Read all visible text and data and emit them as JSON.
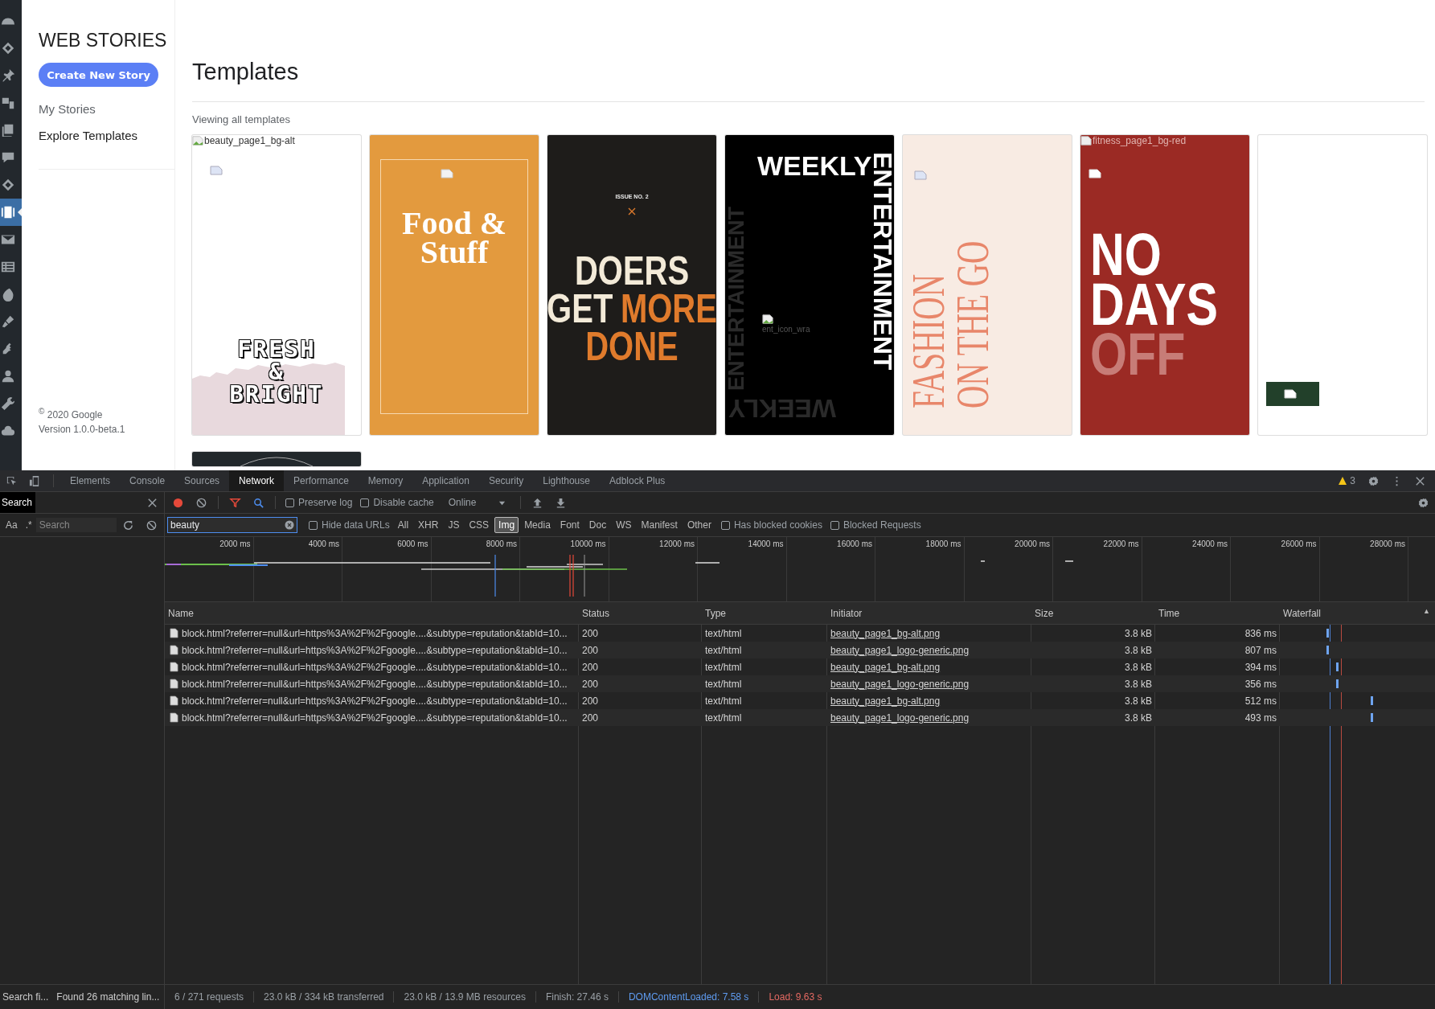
{
  "admin_menu": [
    {
      "selected": false
    },
    {
      "selected": false
    },
    {
      "selected": false
    },
    {
      "selected": false
    },
    {
      "selected": false
    },
    {
      "selected": false
    },
    {
      "selected": false
    },
    {
      "selected": true
    },
    {
      "selected": false
    },
    {
      "selected": false
    },
    {
      "selected": false
    },
    {
      "selected": false
    },
    {
      "selected": false
    },
    {
      "selected": false
    },
    {
      "selected": false
    },
    {
      "selected": false
    }
  ],
  "stories_sidebar": {
    "title": "WEB STORIES",
    "create_button": "Create New Story",
    "nav": [
      {
        "label": "My Stories",
        "selected": false
      },
      {
        "label": "Explore Templates",
        "selected": true
      }
    ],
    "copyright": "$^{©}$ 2020 Google",
    "version": "Version 1.0.0-beta.1"
  },
  "main": {
    "title": "Templates",
    "subtitle": "Viewing all templates",
    "templates": [
      {
        "kind": "beauty",
        "alt": "beauty_page1_bg-alt",
        "lines": [
          "FRESH",
          "&",
          "BRIGHT"
        ]
      },
      {
        "kind": "food",
        "lines": [
          "Food &",
          "Stuff"
        ]
      },
      {
        "kind": "doers",
        "issue": "ISSUE NO. 2",
        "lines": [
          [
            {
              "text": "DOERS",
              "accent": false
            }
          ],
          [
            {
              "text": "GET",
              "accent": false
            },
            {
              "text": "MORE",
              "accent": true
            }
          ],
          [
            {
              "text": "DONE",
              "accent": true
            }
          ]
        ]
      },
      {
        "kind": "weekly",
        "top": "WEEKLY",
        "side": "ENTERTAINMENT",
        "side_faded": "ENTERTAINMENT",
        "bottom_flipped": "WEEKLY",
        "alt": "ent_icon_wra"
      },
      {
        "kind": "fashion",
        "lines": [
          "FASHION",
          "ON THE GO"
        ]
      },
      {
        "kind": "fitness",
        "alt": "fitness_page1_bg-red",
        "lines": [
          {
            "text": "NO",
            "faded": false
          },
          {
            "text": "DAYS",
            "faded": false
          },
          {
            "text": "OFF",
            "faded": true
          }
        ]
      },
      {
        "kind": "blank"
      },
      {
        "kind": "partial"
      }
    ]
  },
  "devtools": {
    "tabs": [
      {
        "label": "Elements",
        "selected": false
      },
      {
        "label": "Console",
        "selected": false
      },
      {
        "label": "Sources",
        "selected": false
      },
      {
        "label": "Network",
        "selected": true
      },
      {
        "label": "Performance",
        "selected": false
      },
      {
        "label": "Memory",
        "selected": false
      },
      {
        "label": "Application",
        "selected": false
      },
      {
        "label": "Security",
        "selected": false
      },
      {
        "label": "Lighthouse",
        "selected": false
      },
      {
        "label": "Adblock Plus",
        "selected": false
      }
    ],
    "warnings": "3",
    "search_panel": {
      "title": "Search",
      "match_case": "Aa",
      "regex": ".*",
      "placeholder": "Search",
      "status": "Search fi...",
      "result": "Found 26 matching lin..."
    },
    "toolbar": {
      "recording": true,
      "filter_active": true,
      "search_active": true,
      "checkboxes": [
        {
          "label": "Preserve log",
          "checked": false
        },
        {
          "label": "Disable cache",
          "checked": false
        }
      ],
      "throttling": "Online"
    },
    "filter": {
      "value": "beauty",
      "hide_data_urls": {
        "label": "Hide data URLs",
        "checked": false
      },
      "types": [
        {
          "label": "All",
          "selected": false
        },
        {
          "label": "XHR",
          "selected": false
        },
        {
          "label": "JS",
          "selected": false
        },
        {
          "label": "CSS",
          "selected": false
        },
        {
          "label": "Img",
          "selected": true
        },
        {
          "label": "Media",
          "selected": false
        },
        {
          "label": "Font",
          "selected": false
        },
        {
          "label": "Doc",
          "selected": false
        },
        {
          "label": "WS",
          "selected": false
        },
        {
          "label": "Manifest",
          "selected": false
        },
        {
          "label": "Other",
          "selected": false
        }
      ],
      "extra_checkboxes": [
        {
          "label": "Has blocked cookies",
          "checked": false
        },
        {
          "label": "Blocked Requests",
          "checked": false
        }
      ]
    },
    "overview": {
      "ticks": [
        "2000 ms",
        "4000 ms",
        "6000 ms",
        "8000 ms",
        "10000 ms",
        "12000 ms",
        "14000 ms",
        "16000 ms",
        "18000 ms",
        "20000 ms",
        "22000 ms",
        "24000 ms",
        "26000 ms",
        "28000 ms"
      ]
    },
    "table": {
      "columns": [
        "Name",
        "Status",
        "Type",
        "Initiator",
        "Size",
        "Time",
        "Waterfall"
      ],
      "sort_indicator": "▲",
      "rows": [
        {
          "name": "block.html?referrer=null&url=https%3A%2F%2Fgoogle....&subtype=reputation&tabId=10...",
          "status": "200",
          "type": "text/html",
          "initiator": "beauty_page1_bg-alt.png",
          "size": "3.8 kB",
          "time": "836 ms"
        },
        {
          "name": "block.html?referrer=null&url=https%3A%2F%2Fgoogle....&subtype=reputation&tabId=10...",
          "status": "200",
          "type": "text/html",
          "initiator": "beauty_page1_logo-generic.png",
          "size": "3.8 kB",
          "time": "807 ms"
        },
        {
          "name": "block.html?referrer=null&url=https%3A%2F%2Fgoogle....&subtype=reputation&tabId=10...",
          "status": "200",
          "type": "text/html",
          "initiator": "beauty_page1_bg-alt.png",
          "size": "3.8 kB",
          "time": "394 ms"
        },
        {
          "name": "block.html?referrer=null&url=https%3A%2F%2Fgoogle....&subtype=reputation&tabId=10...",
          "status": "200",
          "type": "text/html",
          "initiator": "beauty_page1_logo-generic.png",
          "size": "3.8 kB",
          "time": "356 ms"
        },
        {
          "name": "block.html?referrer=null&url=https%3A%2F%2Fgoogle....&subtype=reputation&tabId=10...",
          "status": "200",
          "type": "text/html",
          "initiator": "beauty_page1_bg-alt.png",
          "size": "3.8 kB",
          "time": "512 ms"
        },
        {
          "name": "block.html?referrer=null&url=https%3A%2F%2Fgoogle....&subtype=reputation&tabId=10...",
          "status": "200",
          "type": "text/html",
          "initiator": "beauty_page1_logo-generic.png",
          "size": "3.8 kB",
          "time": "493 ms"
        }
      ]
    },
    "status_bar": [
      {
        "text": "6 / 271 requests",
        "color": "#9aa0a6"
      },
      {
        "text": "23.0 kB / 334 kB transferred",
        "color": "#9aa0a6"
      },
      {
        "text": "23.0 kB / 13.9 MB resources",
        "color": "#9aa0a6"
      },
      {
        "text": "Finish: 27.46 s",
        "color": "#9aa0a6"
      },
      {
        "text": "DOMContentLoaded: 7.58 s",
        "color": "#5e9bf0"
      },
      {
        "text": "Load: 9.63 s",
        "color": "#e46962"
      }
    ]
  }
}
